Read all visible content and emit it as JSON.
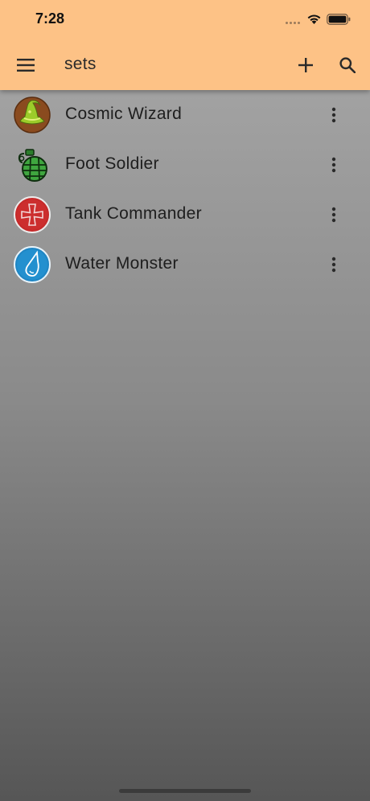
{
  "status_bar": {
    "time": "7:28"
  },
  "app_bar": {
    "title": "sets",
    "menu_icon": "menu-icon",
    "add_icon": "plus-icon",
    "search_icon": "search-icon",
    "background_color": "#fdc286"
  },
  "sets": [
    {
      "name": "Cosmic Wizard",
      "icon": "wizard-hat-icon"
    },
    {
      "name": "Foot Soldier",
      "icon": "grenade-icon"
    },
    {
      "name": "Tank Commander",
      "icon": "iron-cross-icon"
    },
    {
      "name": "Water Monster",
      "icon": "water-drop-icon"
    }
  ]
}
